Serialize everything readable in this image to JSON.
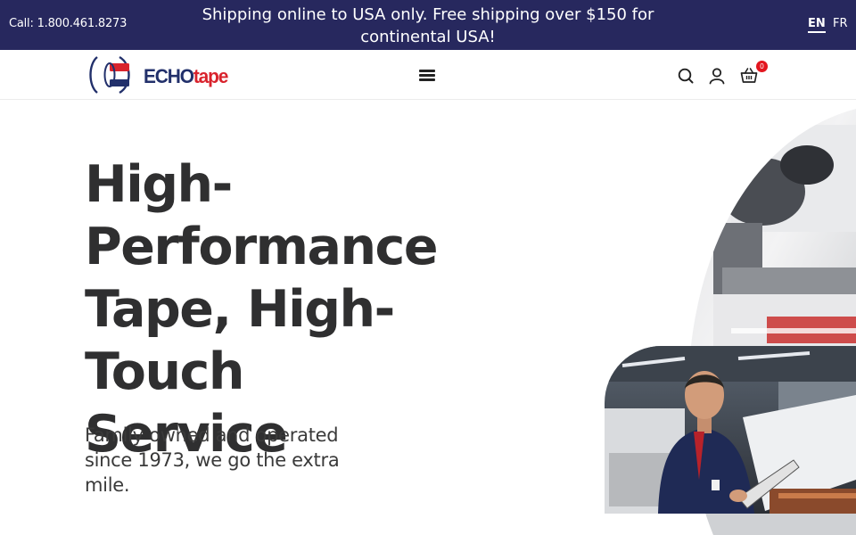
{
  "topbar": {
    "call_text": "Call: 1.800.461.8273",
    "announcement": "Shipping online to USA only. Free shipping over $150 for continental USA!",
    "languages": [
      "EN",
      "FR"
    ],
    "active_language": "EN"
  },
  "header": {
    "logo": {
      "word_primary": "ECHO",
      "word_secondary": "tape"
    },
    "menu_icon": "hamburger-icon",
    "icons": [
      "search-icon",
      "user-icon",
      "cart-icon"
    ],
    "cart_count": "0"
  },
  "hero": {
    "title": "High-Performance Tape, High-Touch Service",
    "subtitle": "Family owned and operated since 1973, we go the extra mile."
  },
  "colors": {
    "topbar_bg": "#27285e",
    "brand_navy": "#22306b",
    "brand_red": "#d9232d",
    "badge_red": "#e3161f",
    "heading_text": "#2f2f30"
  }
}
